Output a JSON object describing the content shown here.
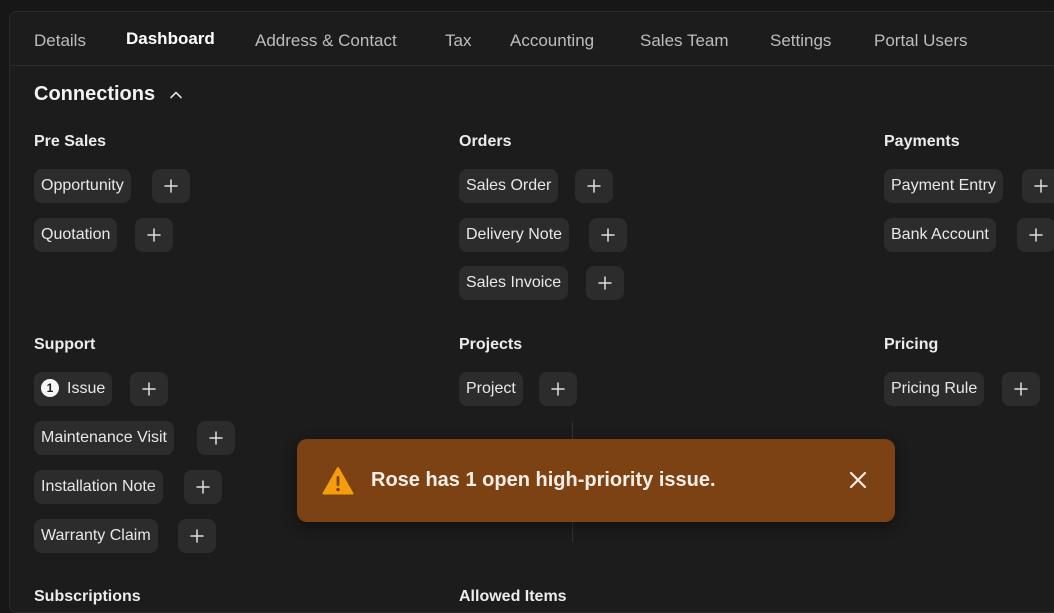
{
  "tabs": [
    {
      "label": "Details"
    },
    {
      "label": "Dashboard"
    },
    {
      "label": "Address & Contact"
    },
    {
      "label": "Tax"
    },
    {
      "label": "Accounting"
    },
    {
      "label": "Sales Team"
    },
    {
      "label": "Settings"
    },
    {
      "label": "Portal Users"
    }
  ],
  "active_tab": "Dashboard",
  "connections": {
    "title": "Connections",
    "toggle_icon": "chevron-up-icon",
    "groups": {
      "pre_sales": {
        "title": "Pre Sales",
        "items": [
          "Opportunity",
          "Quotation"
        ]
      },
      "orders": {
        "title": "Orders",
        "items": [
          "Sales Order",
          "Delivery Note",
          "Sales Invoice"
        ]
      },
      "payments": {
        "title": "Payments",
        "items": [
          "Payment Entry",
          "Bank Account"
        ]
      },
      "support": {
        "title": "Support",
        "items": [
          "Issue",
          "Maintenance Visit",
          "Installation Note",
          "Warranty Claim"
        ],
        "issue_count": "1"
      },
      "projects": {
        "title": "Projects",
        "items": [
          "Project"
        ]
      },
      "pricing": {
        "title": "Pricing",
        "items": [
          "Pricing Rule"
        ]
      },
      "subscriptions": {
        "title": "Subscriptions"
      },
      "allowed_items": {
        "title": "Allowed Items"
      }
    }
  },
  "toast": {
    "message": "Rose has 1 open high-priority issue.",
    "icon": "warning-icon",
    "color": "#7d4213"
  }
}
